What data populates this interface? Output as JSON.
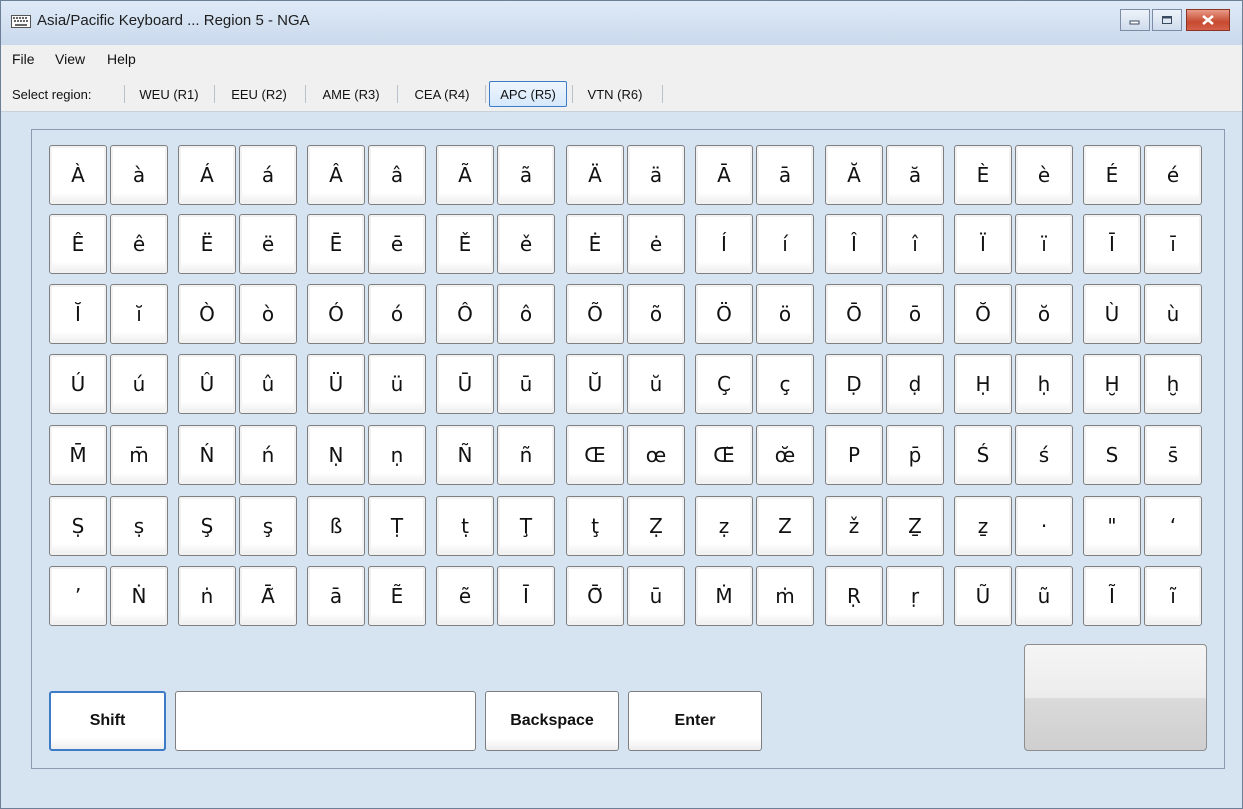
{
  "window": {
    "title": "Asia/Pacific Keyboard ... Region 5 - NGA",
    "icon": "keyboard-icon"
  },
  "menu": [
    "File",
    "View",
    "Help"
  ],
  "regionbar": {
    "label": "Select region:",
    "regions": [
      "WEU (R1)",
      "EEU (R2)",
      "AME (R3)",
      "CEA (R4)",
      "APC (R5)",
      "VTN (R6)"
    ],
    "selected": "APC (R5)"
  },
  "keyboard": {
    "rows": [
      [
        "À",
        "à",
        "Á",
        "á",
        "Â",
        "â",
        "Ã",
        "ã",
        "Ä",
        "ä",
        "Ā",
        "ā",
        "Ă",
        "ă",
        "È",
        "è",
        "É",
        "é"
      ],
      [
        "Ê",
        "ê",
        "Ë",
        "ë",
        "Ē",
        "ē",
        "Ě",
        "ě",
        "Ė",
        "ė",
        "Í",
        "í",
        "Î",
        "î",
        "Ï",
        "ï",
        "Ī",
        "ī"
      ],
      [
        "Ĭ",
        "ĭ",
        "Ò",
        "ò",
        "Ó",
        "ó",
        "Ô",
        "ô",
        "Õ",
        "õ",
        "Ö",
        "ö",
        "Ō",
        "ō",
        "Ŏ",
        "ŏ",
        "Ù",
        "ù"
      ],
      [
        "Ú",
        "ú",
        "Û",
        "û",
        "Ü",
        "ü",
        "Ū",
        "ū",
        "Ŭ",
        "ŭ",
        "Ç",
        "ç",
        "Ḍ",
        "ḍ",
        "Ḥ",
        "ḥ",
        "Ḫ",
        "ḫ"
      ],
      [
        "M̄",
        "m̄",
        "Ń",
        "ń",
        "Ṇ",
        "ṇ",
        "Ñ",
        "ñ",
        "Œ",
        "œ",
        "Œ̆",
        "œ̆",
        "P",
        "p̄",
        "Ś",
        "ś",
        "S",
        "s̄"
      ],
      [
        "Ṣ",
        "ṣ",
        "Ş",
        "ş",
        "ß",
        "Ṭ",
        "ṭ",
        "Ţ",
        "ţ",
        "Ẓ",
        "ẓ",
        "Z",
        "ž",
        "Ẕ",
        "ẕ",
        "·",
        "\"",
        "‘"
      ],
      [
        "’",
        "Ṅ",
        "ṅ",
        "Ā̃",
        "ā",
        "Ẽ",
        "ẽ",
        "Ī",
        "Ō̃",
        "ū",
        "Ṁ",
        "ṁ",
        "Ṛ",
        "ṛ",
        "Ũ",
        "ũ",
        "Ĩ",
        "ĩ"
      ]
    ],
    "shift_label": "Shift",
    "input_value": "",
    "backspace_label": "Backspace",
    "enter_label": "Enter"
  },
  "colors": {
    "panel_bg": "#d6e4f2",
    "accent": "#3d7bc6"
  }
}
